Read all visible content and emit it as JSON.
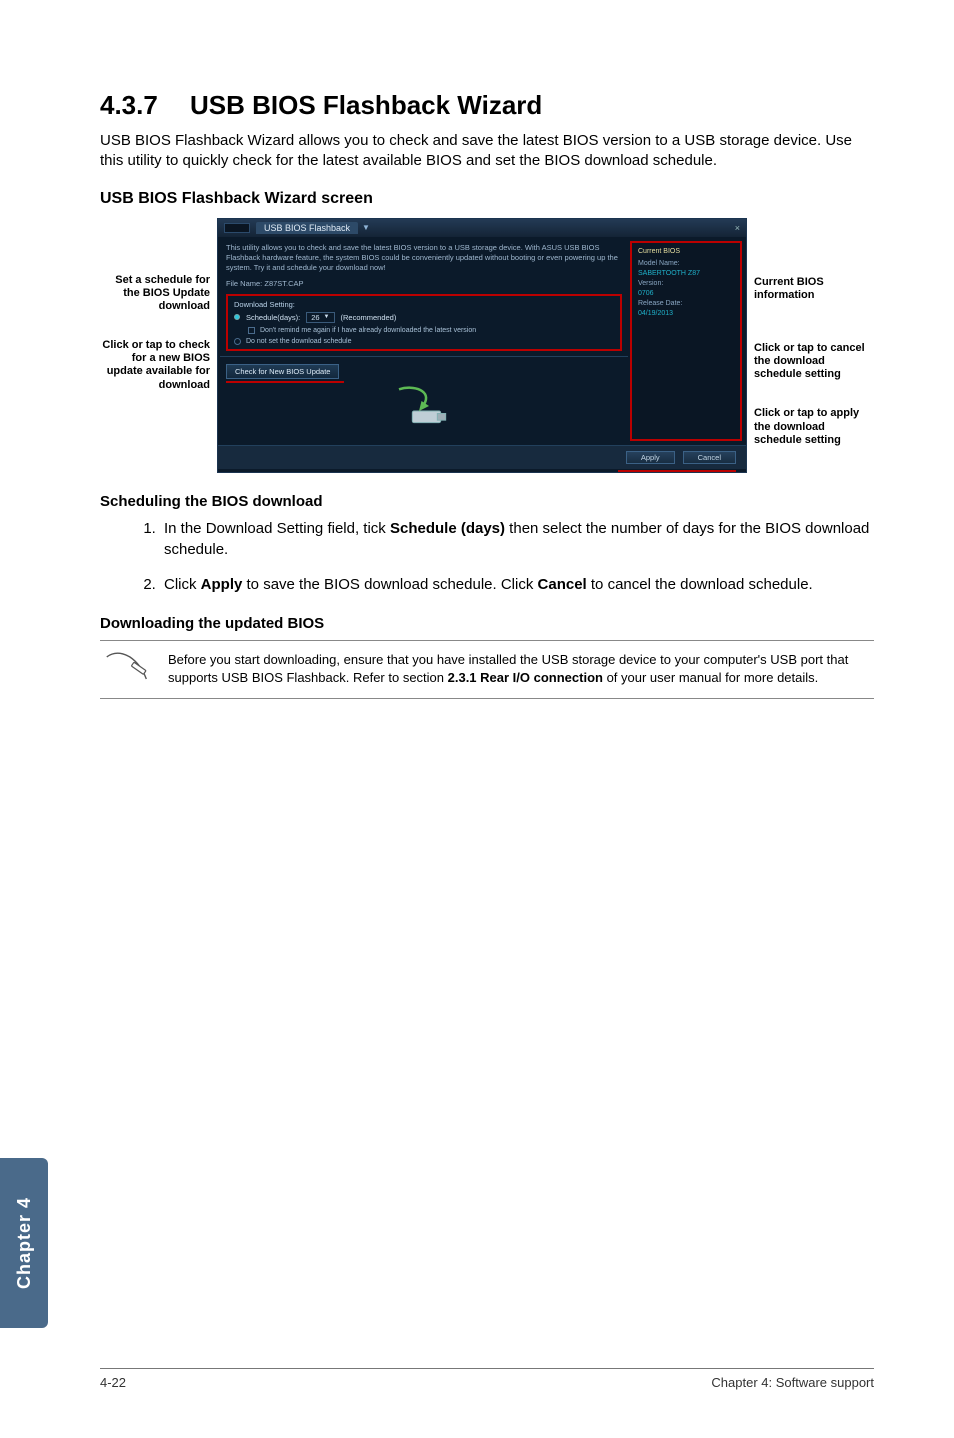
{
  "heading": {
    "number": "4.3.7",
    "title": "USB BIOS Flashback Wizard"
  },
  "intro": "USB BIOS Flashback Wizard allows you to check and save the latest BIOS version to a USB storage device. Use this utility to quickly check for the latest available BIOS and set the BIOS download schedule.",
  "screen_heading": "USB BIOS Flashback Wizard screen",
  "callouts_left": {
    "a": "Set a schedule for the BIOS Update download",
    "b": "Click or tap to check for a new BIOS update available for download"
  },
  "callouts_right": {
    "a": "Current BIOS information",
    "b": "Click or tap to cancel the download schedule setting",
    "c": "Click or tap to apply the download schedule setting"
  },
  "screenshot": {
    "window_title": "USB BIOS Flashback",
    "close": "×",
    "description": "This utility allows you to check and save the latest BIOS version to a USB storage device. With ASUS USB BIOS Flashback hardware feature, the system BIOS could be conveniently updated without booting or even powering up the system. Try it and schedule your download now!",
    "file_label": "File Name:",
    "file_value": "Z87ST.CAP",
    "dl_heading": "Download Setting:",
    "schedule_label": "Schedule(days):",
    "schedule_value": "26",
    "schedule_hint": "(Recommended)",
    "dont_remind": "Don't remind me again if I have already downloaded the latest version",
    "no_schedule": "Do not set the download schedule",
    "check_button": "Check for New BIOS Update",
    "side": {
      "heading": "Current BIOS",
      "model_label": "Model Name:",
      "model_value": "SABERTOOTH Z87",
      "ver_label": "Version:",
      "ver_value": "0706",
      "date_label": "Release Date:",
      "date_value": "04/19/2013"
    },
    "apply": "Apply",
    "cancel": "Cancel"
  },
  "sched_heading": "Scheduling the BIOS download",
  "steps": {
    "s1a": "In the Download Setting field, tick ",
    "s1b": "Schedule (days)",
    "s1c": " then select the number of days for the BIOS download schedule.",
    "s2a": "Click ",
    "s2b": "Apply",
    "s2c": " to save the BIOS download schedule. Click ",
    "s2d": "Cancel",
    "s2e": " to cancel the download schedule."
  },
  "dl_heading2": "Downloading the updated BIOS",
  "note": {
    "line1": "Before you start downloading, ensure that you have installed the USB storage device to your computer's USB port that supports USB BIOS Flashback. Refer to section ",
    "bold": "2.3.1 Rear I/O connection",
    "line2": " of your user manual for more details."
  },
  "chapter_tab": "Chapter 4",
  "footer": {
    "left": "4-22",
    "right": "Chapter 4: Software support"
  }
}
